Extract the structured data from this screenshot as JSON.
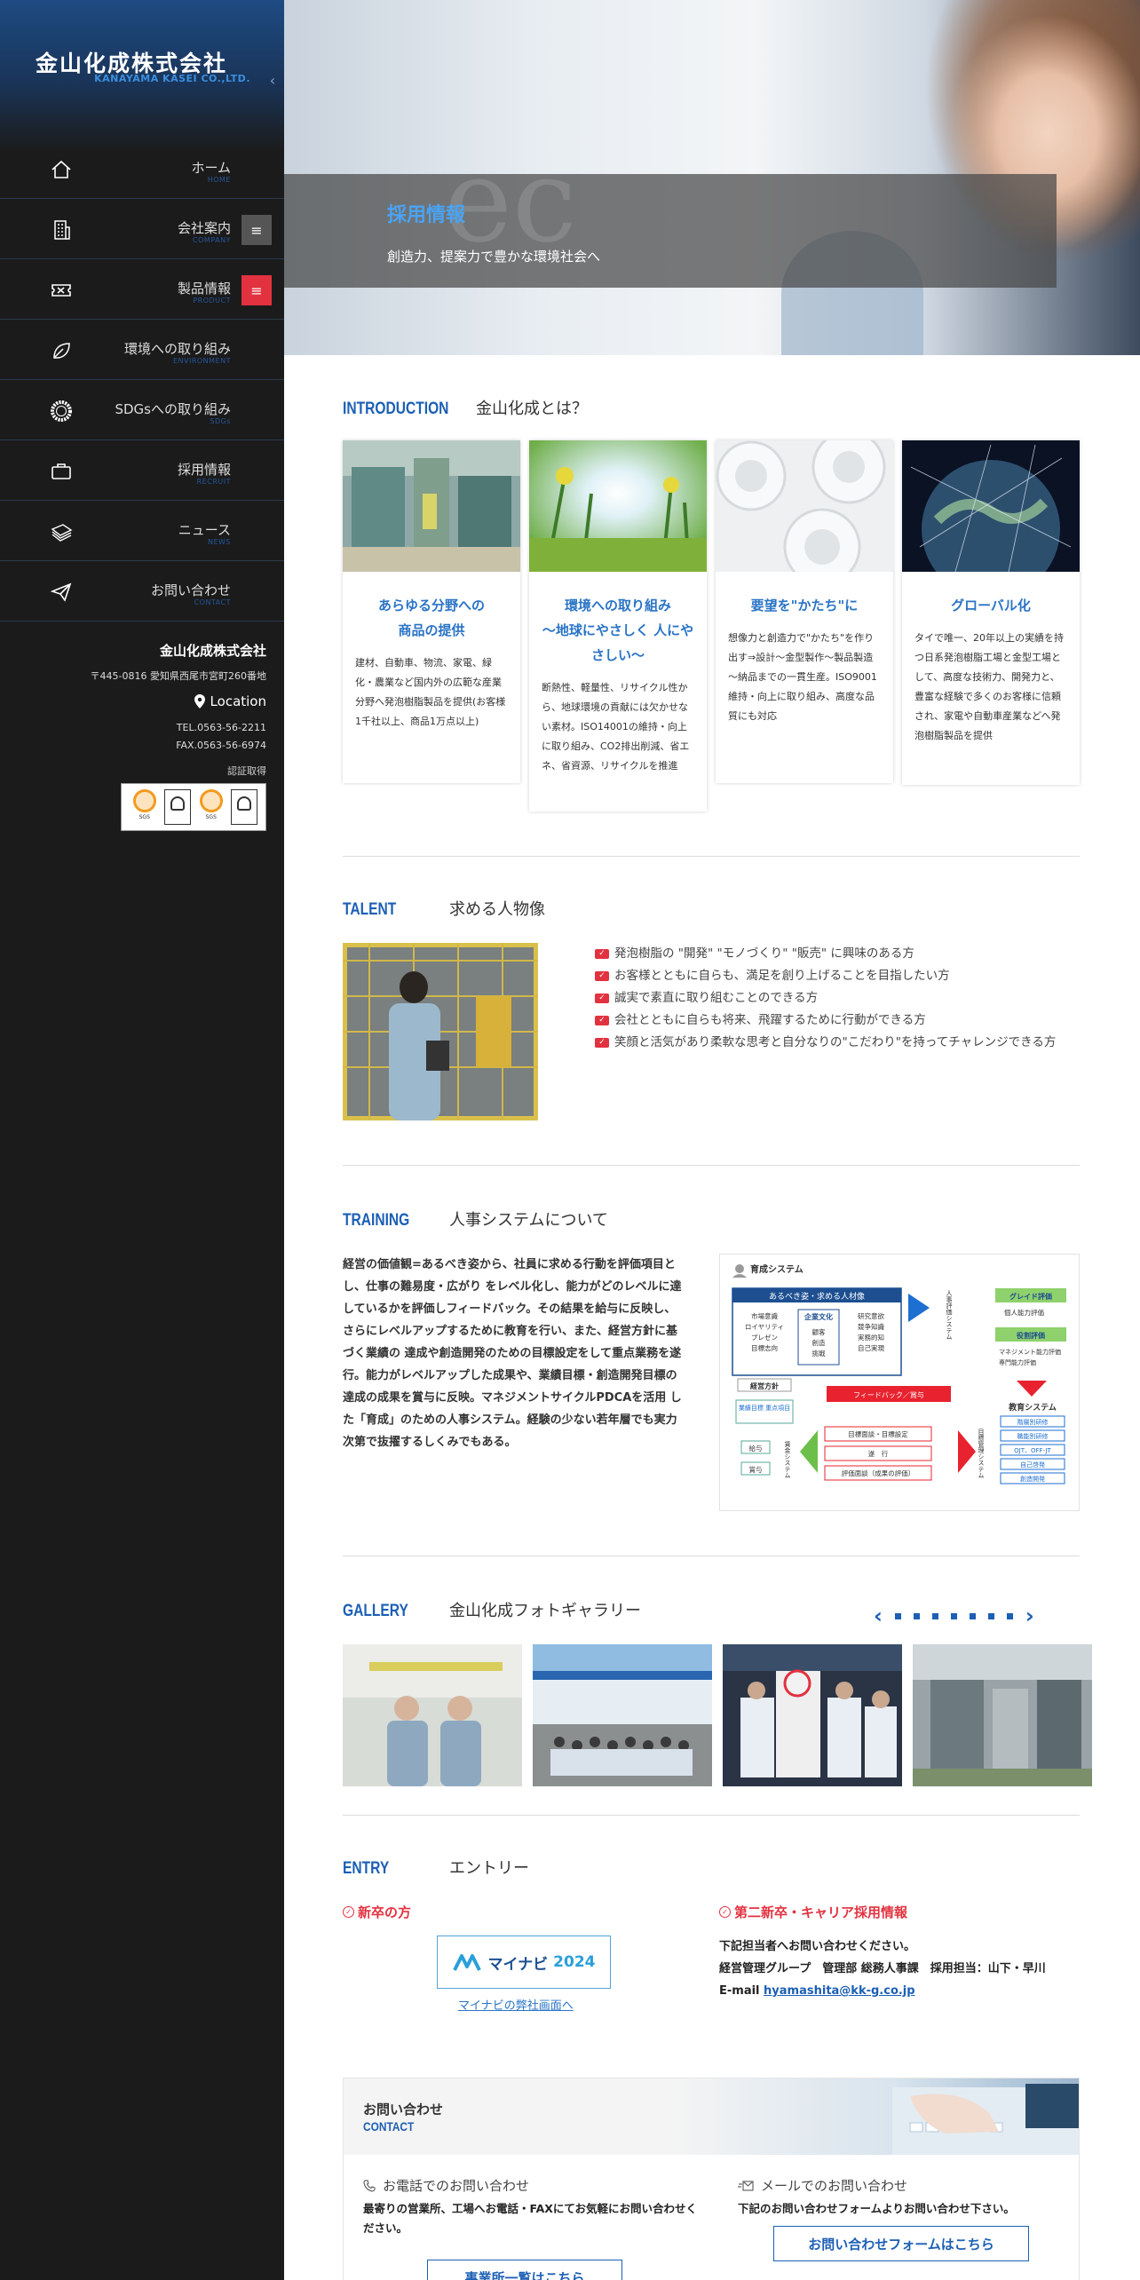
{
  "sidebar": {
    "logo_jp": "金山化成株式会社",
    "logo_en": "KANAYAMA KASEI CO.,LTD.",
    "collapse": "‹",
    "items": [
      {
        "label": "ホーム",
        "sub": "HOME",
        "icon": "home-icon"
      },
      {
        "label": "会社案内",
        "sub": "COMPANY",
        "icon": "building-icon",
        "button": "≡"
      },
      {
        "label": "製品情報",
        "sub": "PRODUCT",
        "icon": "ticket-icon",
        "button": "≡"
      },
      {
        "label": "環境への取り組み",
        "sub": "ENVIRONMENT",
        "icon": "leaf-icon"
      },
      {
        "label": "SDGsへの取り組み",
        "sub": "SDGs",
        "icon": "sdgs-wheel-icon"
      },
      {
        "label": "採用情報",
        "sub": "RECRUIT",
        "icon": "briefcase-icon"
      },
      {
        "label": "ニュース",
        "sub": "NEWS",
        "icon": "newspaper-icon"
      },
      {
        "label": "お問い合わせ",
        "sub": "CONTACT",
        "icon": "paper-plane-icon"
      }
    ],
    "company": {
      "name": "金山化成株式会社",
      "address": "〒445-0816 愛知県西尾市宮町260番地",
      "location": "Location",
      "tel": "TEL.0563-56-2211",
      "fax": "FAX.0563-56-6974",
      "cert_label": "認証取得",
      "cert_sgs": "SGS",
      "cert_ukas": "UKAS"
    }
  },
  "hero": {
    "watermark": "ec",
    "title": "採用情報",
    "subtitle": "創造力、提案力で豊かな環境社会へ"
  },
  "intro": {
    "en": "INTRODUCTION",
    "jp": "金山化成とは？",
    "cards": [
      {
        "title": "あらゆる分野への\n商品の提供",
        "body": "建材、自動車、物流、家電、緑化・農業など国内外の広範な産業分野へ発泡樹脂製品を提供(お客様1千社以上、商品1万点以上)"
      },
      {
        "title": "環境への取り組み\n～地球にやさしく 人にやさしい～",
        "body": "断熱性、軽量性、リサイクル性から、地球環境の貢献には欠かせない素材。ISO14001の維持・向上に取り組み、CO2排出削減、省エネ、省資源、リサイクルを推進"
      },
      {
        "title": "要望を\"かたち\"に",
        "body": "想像力と創造力で\"かたち\"を作り出す⇒設計～金型製作～製品製造～納品までの一貫生産。ISO9001維持・向上に取り組み、高度な品質にも対応"
      },
      {
        "title": "グローバル化",
        "body": "タイで唯一、20年以上の実績を持つ日系発泡樹脂工場と金型工場として、高度な技術力、開発力と、豊富な経験で多くのお客様に信頼され、家電や自動車産業などへ発泡樹脂製品を提供"
      }
    ]
  },
  "talent": {
    "en": "TALENT",
    "jp": "求める人物像",
    "check_glyph": "✓",
    "items": [
      "発泡樹脂の \"開発\" \"モノづくり\" \"販売\" に興味のある方",
      "お客様とともに自らも、満足を創り上げることを目指したい方",
      "誠実で素直に取り組むことのできる方",
      "会社とともに自らも将来、飛躍するために行動ができる方",
      "笑顔と活気があり柔軟な思考と自分なりの\"こだわり\"を持ってチャレンジできる方"
    ]
  },
  "training": {
    "en": "TRAINING",
    "jp": "人事システムについて",
    "text": "経営の価値観=あるべき姿から、社員に求める行動を評価項目とし、仕事の難易度・広がり をレベル化し、能力がどのレベルに達しているかを評価しフィードバック。その結果を給与に反映し、さらにレベルアップするために教育を行い、また、経営方針に基づく業績の 達成や創造開発のための目標設定をして重点業務を遂行。能力がレベルアップした成果や、業績目標・創造開発目標の達成の成果を賞与に反映。マネジメントサイクルPDCAを活用 した「育成」のための人事システム。経験の少ない若年層でも実力次第で抜擢するしくみでもある。",
    "diagram": {
      "title": "育成システム",
      "top_box": "あるべき姿・求める人材像",
      "col1": [
        "市場意識",
        "ロイヤリティ",
        "プレゼン",
        "目標志向"
      ],
      "culture": "企業文化",
      "col2": [
        "顧客",
        "創造",
        "挑戦"
      ],
      "col3": [
        "研究意欲",
        "競争知識",
        "実務的知",
        "自己実現"
      ],
      "side1": "人事評価システム",
      "grade": "グレイド評価",
      "grade_item": "個人能力評価",
      "role": "役割評価",
      "role_items": [
        "マネジメント能力評価",
        "専門能力評価"
      ],
      "policy": "経営方針",
      "goal": "業績目標\n重点項目",
      "feedback": "フィードバック／賞与",
      "edu": "教育システム",
      "edu_items": [
        "階層別研修",
        "職能別研修",
        "OJT、OFF-JT",
        "自己啓発",
        "創造開発"
      ],
      "pay1": "給与",
      "pay2": "賞与",
      "side2": "賃金システム",
      "steps": [
        "目標面談・目標設定",
        "遂　行",
        "評価面談（成果の評価）"
      ],
      "side3": "目標管理システム"
    }
  },
  "gallery": {
    "en": "GALLERY",
    "jp": "金山化成フォトギャラリー",
    "prev": "‹",
    "next": "›",
    "dots": 7
  },
  "entry": {
    "en": "ENTRY",
    "jp": "エントリー",
    "new_grad": "新卒の方",
    "mynavi_logo": "マイナビ",
    "mynavi_year": "2024",
    "mynavi_link": "マイナビの弊社画面へ",
    "career": "第二新卒・キャリア採用情報",
    "career_l1": "下記担当者へお問い合わせください。",
    "career_l2": "経営管理グループ　管理部 総務人事課　採用担当：山下・早川",
    "email_label": "E-mail ",
    "email": "hyamashita@kk-g.co.jp"
  },
  "contact": {
    "title": "お問い合わせ",
    "en": "CONTACT",
    "phone_h": "お電話でのお問い合わせ",
    "phone_p": "最寄りの営業所、工場へお電話・FAXにてお気軽にお問い合わせください。",
    "phone_btn": "事業所一覧はこちら",
    "mail_h": "メールでのお問い合わせ",
    "mail_p": "下記のお問い合わせフォームよりお問い合わせ下さい。",
    "mail_btn": "お問い合わせフォームはこちら"
  },
  "colors": {
    "accent": "#1c5fb5",
    "red": "#e23240",
    "sidebar": "#1b1b1b"
  }
}
